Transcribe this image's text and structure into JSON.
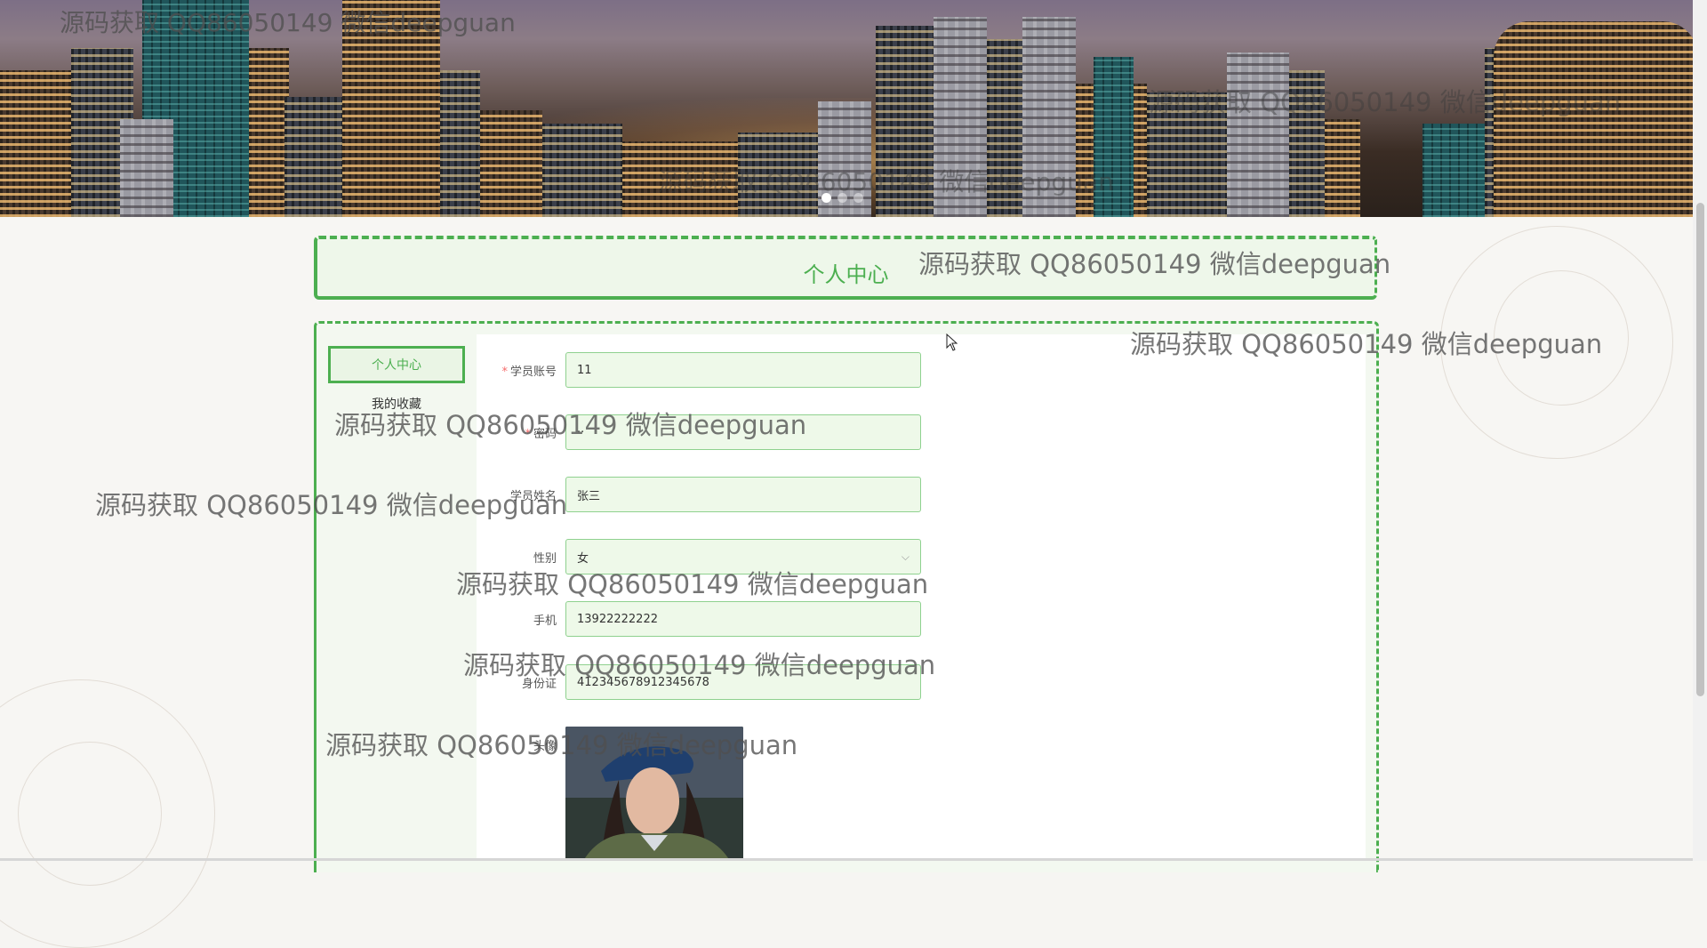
{
  "banner": {
    "slides": 3,
    "active_slide": 1
  },
  "page": {
    "title": "个人中心"
  },
  "sidebar": {
    "items": [
      {
        "label": "个人中心",
        "active": true
      },
      {
        "label": "我的收藏",
        "active": false
      }
    ]
  },
  "form": {
    "account": {
      "label": "学员账号",
      "required": true,
      "value": "11"
    },
    "password": {
      "label": "密码",
      "required": true,
      "value": "··"
    },
    "name": {
      "label": "学员姓名",
      "required": false,
      "value": "张三"
    },
    "gender": {
      "label": "性别",
      "required": false,
      "value": "女"
    },
    "phone": {
      "label": "手机",
      "required": false,
      "value": "13922222222"
    },
    "id_card": {
      "label": "身份证",
      "required": false,
      "value": "412345678912345678"
    },
    "avatar": {
      "label": "头像"
    }
  },
  "watermarks": [
    "源码获取 QQ86050149 微信deepguan",
    "源码获取 QQ86050149 微信deepguan",
    "源码获取 QQ86050149 微信deepguan",
    "源码获取 QQ86050149 微信deepguan",
    "源码获取 QQ86050149 微信deepguan",
    "源码获取 QQ86050149 微信deepguan",
    "源码获取 QQ86050149 微信deepguan",
    "源码获取 QQ86050149 微信deepguan",
    "源码获取 QQ86050149 微信deepguan",
    "源码获取 QQ86050149 微信deepguan",
    "源码获取 QQ86050149 微信deepguan"
  ],
  "colors": {
    "accent": "#4caf50",
    "field_bg": "#eef9e9",
    "required": "#f56c6c"
  }
}
